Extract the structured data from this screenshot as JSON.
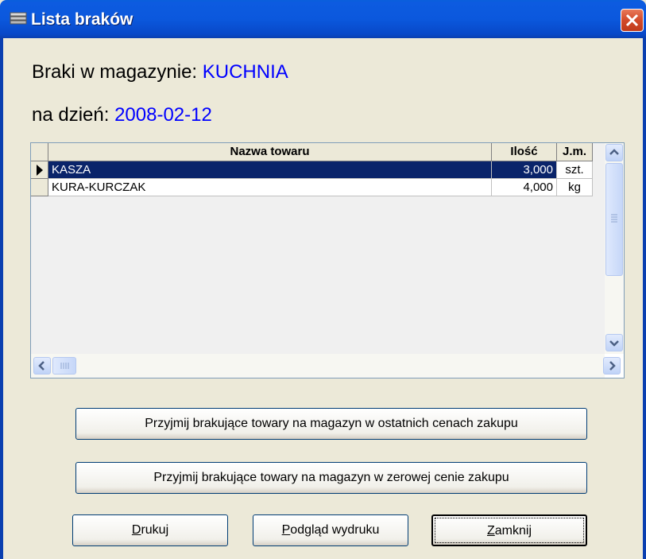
{
  "window": {
    "title": "Lista braków",
    "close_icon": "close-icon",
    "app_icon": "list-icon"
  },
  "header": {
    "warehouse_label": "Braki w magazynie:",
    "warehouse_value": "KUCHNIA",
    "date_label": "na dzień:",
    "date_value": "2008-02-12"
  },
  "table": {
    "columns": [
      "Nazwa towaru",
      "Ilość",
      "J.m."
    ],
    "rows": [
      {
        "name": "KASZA",
        "qty": "3,000",
        "unit": "szt.",
        "selected": true
      },
      {
        "name": "KURA-KURCZAK",
        "qty": "4,000",
        "unit": "kg",
        "selected": false
      }
    ]
  },
  "buttons": {
    "accept_last_prices": "Przyjmij brakujące towary na magazyn w ostatnich cenach zakupu",
    "accept_zero_price": "Przyjmij brakujące towary na magazyn w zerowej cenie zakupu",
    "print_u": "D",
    "print_rest": "rukuj",
    "preview_u": "P",
    "preview_rest": "odgląd wydruku",
    "close_u": "Z",
    "close_rest": "amknij"
  },
  "colors": {
    "title_bar": "#0a5fdc",
    "value_text": "#0000ff",
    "selection": "#0a246a",
    "background": "#ece9d8"
  }
}
